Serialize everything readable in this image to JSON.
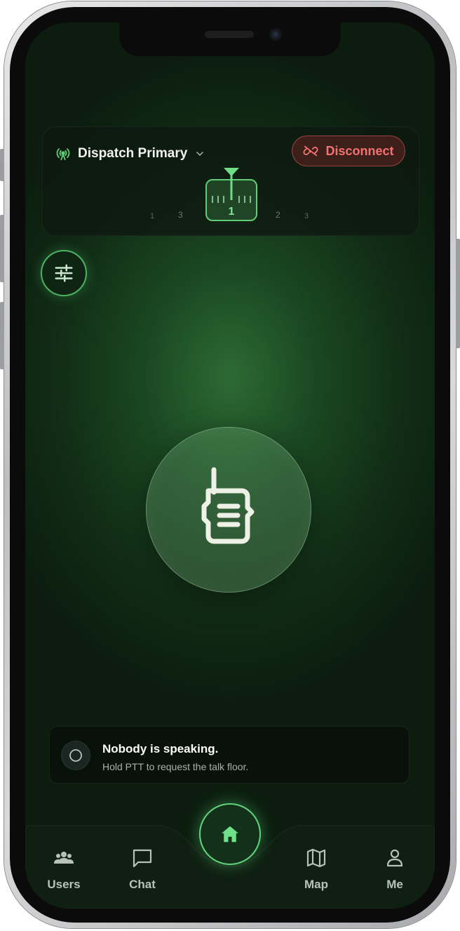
{
  "channel": {
    "name": "Dispatch Primary",
    "disconnect_label": "Disconnect",
    "dial": {
      "selected": "1",
      "left_labels": [
        "3"
      ],
      "right_labels": [
        "2"
      ]
    }
  },
  "status": {
    "title": "Nobody is speaking.",
    "subtitle": "Hold PTT to request the talk floor."
  },
  "nav": {
    "items": [
      {
        "label": "Users",
        "icon": "users-icon"
      },
      {
        "label": "Chat",
        "icon": "chat-icon"
      },
      {
        "label": "Map",
        "icon": "map-icon"
      },
      {
        "label": "Me",
        "icon": "user-icon"
      }
    ],
    "home_icon": "home-icon"
  },
  "colors": {
    "accent": "#5fcd77",
    "danger": "#f07272",
    "background": "#1a4721"
  }
}
